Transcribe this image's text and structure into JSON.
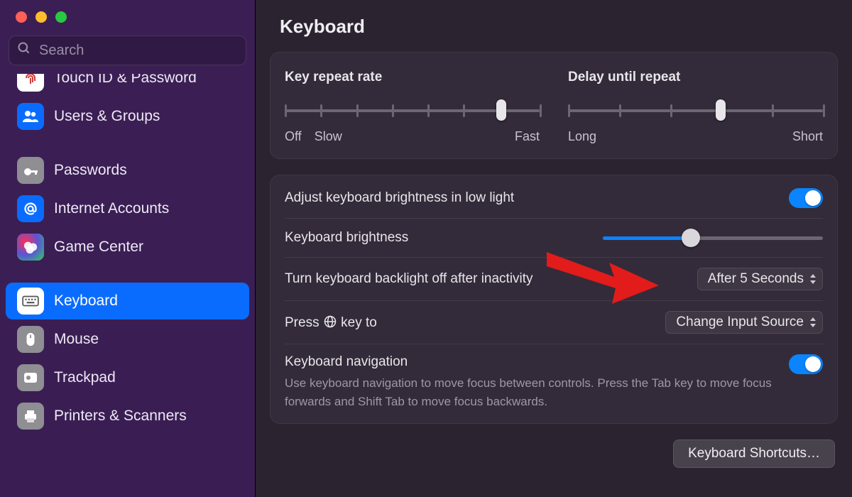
{
  "search": {
    "placeholder": "Search"
  },
  "sidebar": {
    "touchid": {
      "label": "Touch ID & Password"
    },
    "users": {
      "label": "Users & Groups"
    },
    "passwords": {
      "label": "Passwords"
    },
    "internet": {
      "label": "Internet Accounts"
    },
    "gamecenter": {
      "label": "Game Center"
    },
    "keyboard": {
      "label": "Keyboard"
    },
    "mouse": {
      "label": "Mouse"
    },
    "trackpad": {
      "label": "Trackpad"
    },
    "printers": {
      "label": "Printers & Scanners"
    }
  },
  "page": {
    "title": "Keyboard"
  },
  "repeat": {
    "rate": {
      "label": "Key repeat rate",
      "left": "Off",
      "left2": "Slow",
      "right": "Fast",
      "value_pct": 85
    },
    "delay": {
      "label": "Delay until repeat",
      "left": "Long",
      "right": "Short",
      "value_pct": 60
    }
  },
  "brightness": {
    "auto": {
      "label": "Adjust keyboard brightness in low light",
      "on": true
    },
    "level": {
      "label": "Keyboard brightness",
      "value_pct": 40
    },
    "offafter": {
      "label": "Turn keyboard backlight off after inactivity",
      "value": "After 5 Seconds"
    },
    "globe": {
      "label_pre": "Press ",
      "label_post": " key to",
      "value": "Change Input Source"
    },
    "keynav": {
      "label": "Keyboard navigation",
      "desc": "Use keyboard navigation to move focus between controls. Press the Tab key to move focus forwards and Shift Tab to move focus backwards.",
      "on": true
    }
  },
  "footer": {
    "shortcuts": "Keyboard Shortcuts…"
  }
}
